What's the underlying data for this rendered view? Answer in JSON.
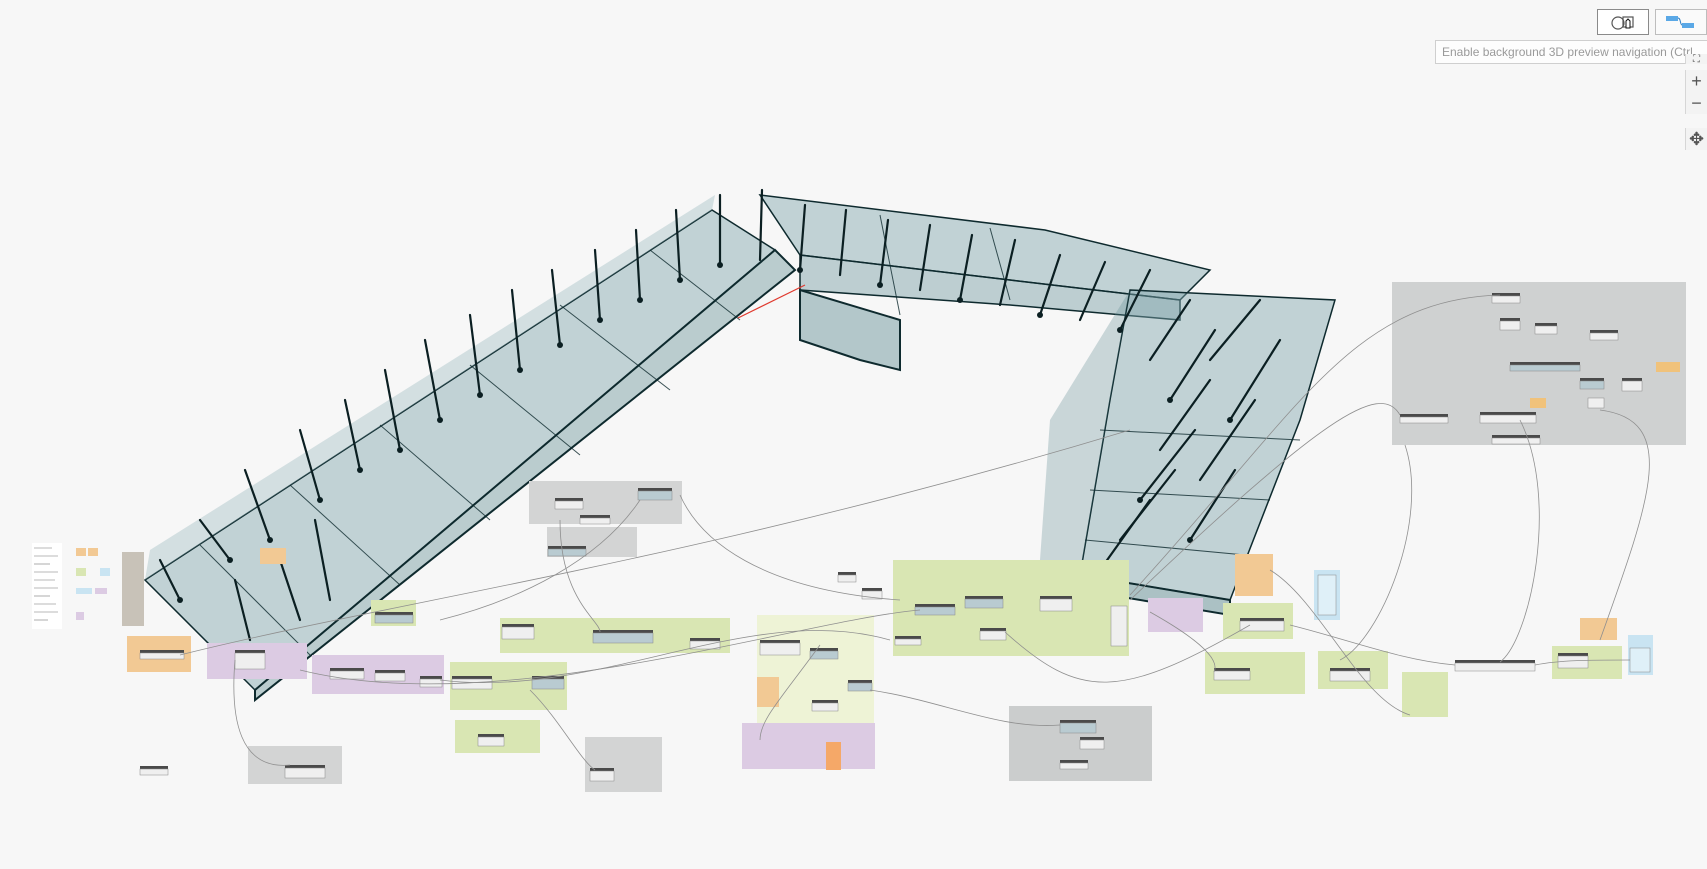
{
  "toolbar": {
    "geometry_view_button": "background-3d-preview-toggle",
    "graph_view_button": "graph-view-toggle"
  },
  "tooltip": {
    "text": "Enable background 3D preview navigation (Ctrl"
  },
  "navigation": {
    "zoom_in_label": "+",
    "zoom_out_label": "−",
    "pan_label": "✥"
  },
  "colors": {
    "background": "#f7f7f7",
    "building_fill": "#5f8c92",
    "building_stroke": "#0e2a2e",
    "group_green": "#d9e6b3",
    "group_light_green": "#eef3d6",
    "group_gray": "#cfd1d1",
    "group_orange": "#f2c994",
    "group_purple": "#dccbe3",
    "group_blue": "#c9e4f2",
    "node_header": "#4a4a4a",
    "node_body": "#efefef",
    "wire": "#8f8f8f",
    "axis_red": "#e03a2f"
  },
  "icons": [
    "geometry-view-icon",
    "graph-view-icon",
    "hand-cursor-icon",
    "zoom-in-icon",
    "zoom-out-icon",
    "pan-icon",
    "fit-view-icon"
  ]
}
